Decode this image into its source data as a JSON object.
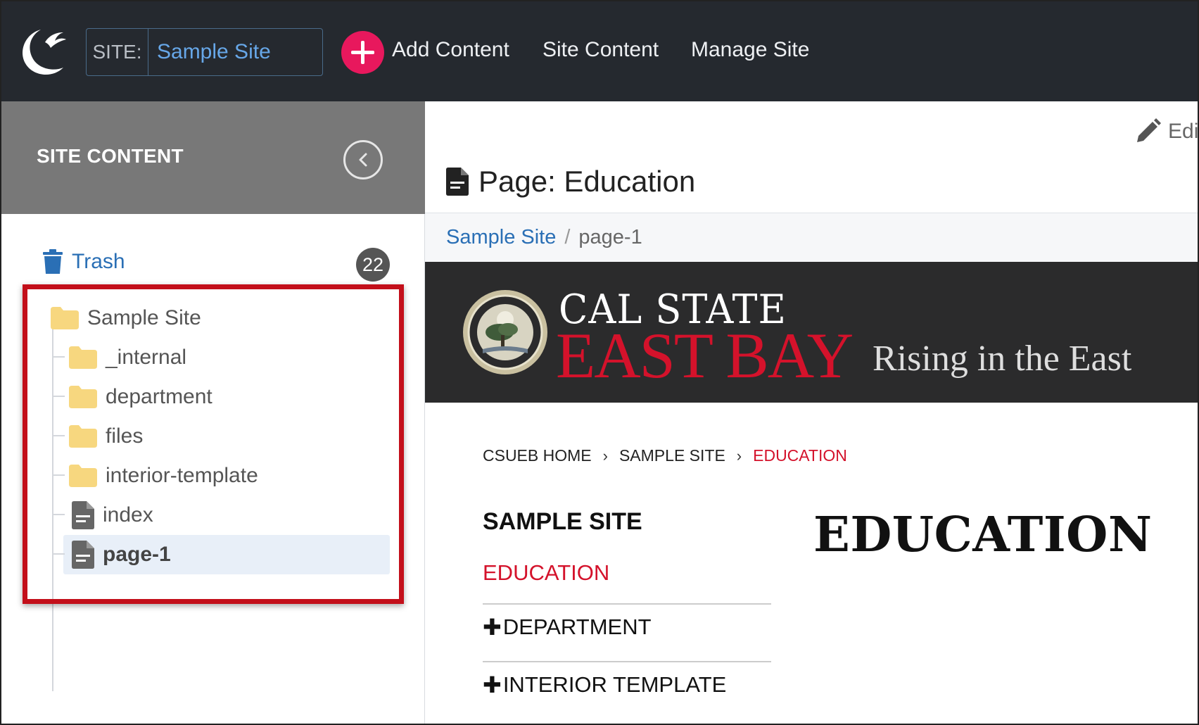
{
  "topbar": {
    "logo_icon": "cascade-moon-bird-logo-icon",
    "site_label": "SITE:",
    "site_value": "Sample Site",
    "add_icon": "plus-circle-icon",
    "add_label": "Add Content",
    "site_content_label": "Site Content",
    "manage_site_label": "Manage Site",
    "bg_color": "#25292f",
    "accent_color": "#e8185d"
  },
  "sidebar": {
    "title": "SITE CONTENT",
    "collapse_icon": "chevron-left-circle-icon",
    "trash": {
      "label": "Trash",
      "icon": "trash-icon",
      "count": "22"
    },
    "tree": [
      {
        "label": "Sample Site",
        "icon": "folder-icon",
        "type": "folder",
        "level": 0
      },
      {
        "label": "_internal",
        "icon": "folder-icon",
        "type": "folder",
        "level": 1
      },
      {
        "label": "department",
        "icon": "folder-icon",
        "type": "folder",
        "level": 1
      },
      {
        "label": "files",
        "icon": "folder-icon",
        "type": "folder",
        "level": 1
      },
      {
        "label": "interior-template",
        "icon": "folder-icon",
        "type": "folder",
        "level": 1
      },
      {
        "label": "index",
        "icon": "page-icon",
        "type": "page",
        "level": 1
      },
      {
        "label": "page-1",
        "icon": "page-icon",
        "type": "page",
        "level": 1,
        "selected": true
      }
    ],
    "highlight_color": "#c30f1a"
  },
  "main": {
    "edit_icon": "pencil-icon",
    "edit_label": "Edit",
    "page_icon": "page-icon",
    "page_title": "Page: Education",
    "breadcrumb": {
      "site": "Sample Site",
      "separator": "/",
      "page": "page-1"
    },
    "preview": {
      "seal_icon": "university-seal-icon",
      "brand_top": "CAL STATE",
      "brand_main": "EAST BAY",
      "brand_tagline": "Rising in the East",
      "crumbs": [
        "CSUEB HOME",
        "SAMPLE SITE",
        "EDUCATION"
      ],
      "chevron": "›",
      "nav_title": "SAMPLE SITE",
      "nav_active": "EDUCATION",
      "nav_plus": "✚",
      "nav_items": [
        "DEPARTMENT",
        "INTERIOR TEMPLATE"
      ],
      "heading": "EDUCATION",
      "brand_red": "#d4122b"
    }
  }
}
